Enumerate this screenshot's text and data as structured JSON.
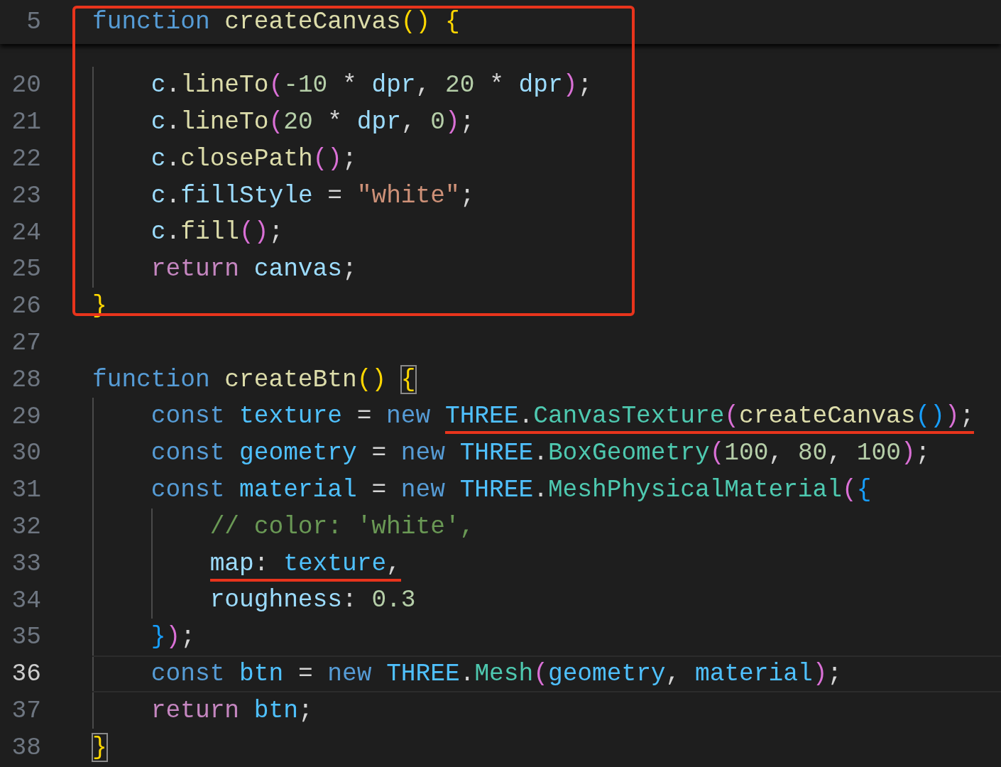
{
  "highlight_box": {
    "lines": [
      {
        "number": "5",
        "kind": "sticky",
        "current": false,
        "tokens": [
          {
            "text": "function ",
            "kind": "kw"
          },
          {
            "text": "createCanvas",
            "kind": "fn"
          },
          {
            "text": "() ",
            "kind": "b1"
          },
          {
            "text": "{",
            "kind": "b1"
          }
        ],
        "children": [
          {
            "number": "20",
            "kind": "normal",
            "current": false,
            "tokens": [
              {
                "text": "c",
                "kind": "var"
              },
              {
                "text": ".",
                "kind": "op"
              },
              {
                "text": "lineTo",
                "kind": "fn"
              },
              {
                "text": "(",
                "kind": "b2"
              },
              {
                "text": "-10",
                "kind": "num"
              },
              {
                "text": " * ",
                "kind": "op"
              },
              {
                "text": "dpr",
                "kind": "var"
              },
              {
                "text": ", ",
                "kind": "op"
              },
              {
                "text": "20",
                "kind": "num"
              },
              {
                "text": " * ",
                "kind": "op"
              },
              {
                "text": "dpr",
                "kind": "var"
              },
              {
                "text": ")",
                "kind": "b2"
              },
              {
                "text": ";",
                "kind": "op"
              }
            ]
          },
          {
            "number": "21",
            "kind": "normal",
            "current": false,
            "tokens": [
              {
                "text": "c",
                "kind": "var"
              },
              {
                "text": ".",
                "kind": "op"
              },
              {
                "text": "lineTo",
                "kind": "fn"
              },
              {
                "text": "(",
                "kind": "b2"
              },
              {
                "text": "20",
                "kind": "num"
              },
              {
                "text": " * ",
                "kind": "op"
              },
              {
                "text": "dpr",
                "kind": "var"
              },
              {
                "text": ", ",
                "kind": "op"
              },
              {
                "text": "0",
                "kind": "num"
              },
              {
                "text": ")",
                "kind": "b2"
              },
              {
                "text": ";",
                "kind": "op"
              }
            ]
          },
          {
            "number": "22",
            "kind": "normal",
            "current": false,
            "tokens": [
              {
                "text": "c",
                "kind": "var"
              },
              {
                "text": ".",
                "kind": "op"
              },
              {
                "text": "closePath",
                "kind": "fn"
              },
              {
                "text": "()",
                "kind": "b2"
              },
              {
                "text": ";",
                "kind": "op"
              }
            ]
          },
          {
            "number": "23",
            "kind": "normal",
            "current": false,
            "tokens": [
              {
                "text": "c",
                "kind": "var"
              },
              {
                "text": ".",
                "kind": "op"
              },
              {
                "text": "fillStyle",
                "kind": "var"
              },
              {
                "text": " = ",
                "kind": "op"
              },
              {
                "text": "\"white\"",
                "kind": "str"
              },
              {
                "text": ";",
                "kind": "op"
              }
            ]
          },
          {
            "number": "24",
            "kind": "normal",
            "current": false,
            "tokens": [
              {
                "text": "c",
                "kind": "var"
              },
              {
                "text": ".",
                "kind": "op"
              },
              {
                "text": "fill",
                "kind": "fn"
              },
              {
                "text": "()",
                "kind": "b2"
              },
              {
                "text": ";",
                "kind": "op"
              }
            ]
          },
          {
            "number": "25",
            "kind": "normal",
            "current": false,
            "tokens": [
              {
                "text": "return ",
                "kind": "ctrl"
              },
              {
                "text": "canvas",
                "kind": "var"
              },
              {
                "text": ";",
                "kind": "op"
              }
            ]
          }
        ]
      },
      {
        "number": "26",
        "kind": "normal",
        "current": false,
        "tokens": [
          {
            "text": "}",
            "kind": "b1"
          }
        ]
      }
    ]
  },
  "lines": [
    {
      "number": "27",
      "kind": "normal",
      "current": false
    },
    {
      "number": "28",
      "kind": "normal",
      "current": false,
      "tokens": [
        {
          "text": "function ",
          "kind": "kw"
        },
        {
          "text": "createBtn",
          "kind": "fn"
        },
        {
          "text": "() ",
          "kind": "b1"
        },
        {
          "text": "{",
          "kind": "b1",
          "bracket_match": true
        }
      ],
      "children": [
        {
          "number": "29",
          "kind": "normal",
          "current": false,
          "tokens": [
            {
              "text": "const ",
              "kind": "kw"
            },
            {
              "text": "texture",
              "kind": "const"
            },
            {
              "text": " = ",
              "kind": "op"
            },
            {
              "text": "new ",
              "kind": "kw"
            },
            {
              "text": "THREE",
              "kind": "const",
              "underlined": true
            },
            {
              "text": ".",
              "kind": "op",
              "underlined": true
            },
            {
              "text": "CanvasTexture",
              "kind": "cls",
              "underlined": true
            },
            {
              "text": "(",
              "kind": "b2",
              "underlined": true
            },
            {
              "text": "createCanvas",
              "kind": "fn",
              "underlined": true
            },
            {
              "text": "()",
              "kind": "b3",
              "underlined": true
            },
            {
              "text": ")",
              "kind": "b2",
              "underlined": true
            },
            {
              "text": ";",
              "kind": "op",
              "underlined": true
            }
          ]
        },
        {
          "number": "30",
          "kind": "normal",
          "current": false,
          "tokens": [
            {
              "text": "const ",
              "kind": "kw"
            },
            {
              "text": "geometry",
              "kind": "const"
            },
            {
              "text": " = ",
              "kind": "op"
            },
            {
              "text": "new ",
              "kind": "kw"
            },
            {
              "text": "THREE",
              "kind": "const"
            },
            {
              "text": ".",
              "kind": "op"
            },
            {
              "text": "BoxGeometry",
              "kind": "cls"
            },
            {
              "text": "(",
              "kind": "b2"
            },
            {
              "text": "100",
              "kind": "num"
            },
            {
              "text": ", ",
              "kind": "op"
            },
            {
              "text": "80",
              "kind": "num"
            },
            {
              "text": ", ",
              "kind": "op"
            },
            {
              "text": "100",
              "kind": "num"
            },
            {
              "text": ")",
              "kind": "b2"
            },
            {
              "text": ";",
              "kind": "op"
            }
          ]
        },
        {
          "number": "31",
          "kind": "normal",
          "current": false,
          "tokens": [
            {
              "text": "const ",
              "kind": "kw"
            },
            {
              "text": "material",
              "kind": "const"
            },
            {
              "text": " = ",
              "kind": "op"
            },
            {
              "text": "new ",
              "kind": "kw"
            },
            {
              "text": "THREE",
              "kind": "const"
            },
            {
              "text": ".",
              "kind": "op"
            },
            {
              "text": "MeshPhysicalMaterial",
              "kind": "cls"
            },
            {
              "text": "(",
              "kind": "b2"
            },
            {
              "text": "{",
              "kind": "b3"
            }
          ],
          "children": [
            {
              "number": "32",
              "kind": "normal",
              "current": false,
              "tokens": [
                {
                  "text": "// color: 'white',",
                  "kind": "cmt"
                }
              ]
            },
            {
              "number": "33",
              "kind": "normal",
              "current": false,
              "tokens": [
                {
                  "text": "map",
                  "kind": "var",
                  "underlined": true
                },
                {
                  "text": ": ",
                  "kind": "op",
                  "underlined": true
                },
                {
                  "text": "texture",
                  "kind": "const",
                  "underlined": true
                },
                {
                  "text": ",",
                  "kind": "op",
                  "underlined": true
                }
              ]
            },
            {
              "number": "34",
              "kind": "normal",
              "current": false,
              "tokens": [
                {
                  "text": "roughness",
                  "kind": "var"
                },
                {
                  "text": ": ",
                  "kind": "op"
                },
                {
                  "text": "0.3",
                  "kind": "num"
                }
              ]
            }
          ]
        },
        {
          "number": "35",
          "kind": "normal",
          "current": false,
          "tokens": [
            {
              "text": "}",
              "kind": "b3"
            },
            {
              "text": ")",
              "kind": "b2"
            },
            {
              "text": ";",
              "kind": "op"
            }
          ]
        },
        {
          "number": "36",
          "kind": "normal",
          "current": true,
          "tokens": [
            {
              "text": "const ",
              "kind": "kw"
            },
            {
              "text": "btn",
              "kind": "const"
            },
            {
              "text": " = ",
              "kind": "op"
            },
            {
              "text": "new ",
              "kind": "kw"
            },
            {
              "text": "THREE",
              "kind": "const"
            },
            {
              "text": ".",
              "kind": "op"
            },
            {
              "text": "Mesh",
              "kind": "cls"
            },
            {
              "text": "(",
              "kind": "b2"
            },
            {
              "text": "geometry",
              "kind": "const"
            },
            {
              "text": ", ",
              "kind": "op"
            },
            {
              "text": "material",
              "kind": "const"
            },
            {
              "text": ")",
              "kind": "b2"
            },
            {
              "text": ";",
              "kind": "op"
            }
          ]
        },
        {
          "number": "37",
          "kind": "normal",
          "current": false,
          "tokens": [
            {
              "text": "return ",
              "kind": "ctrl"
            },
            {
              "text": "btn",
              "kind": "const"
            },
            {
              "text": ";",
              "kind": "op"
            }
          ]
        }
      ]
    },
    {
      "number": "38",
      "kind": "normal",
      "current": false,
      "tokens": [
        {
          "text": "}",
          "kind": "b1",
          "bracket_match": true
        }
      ]
    }
  ]
}
